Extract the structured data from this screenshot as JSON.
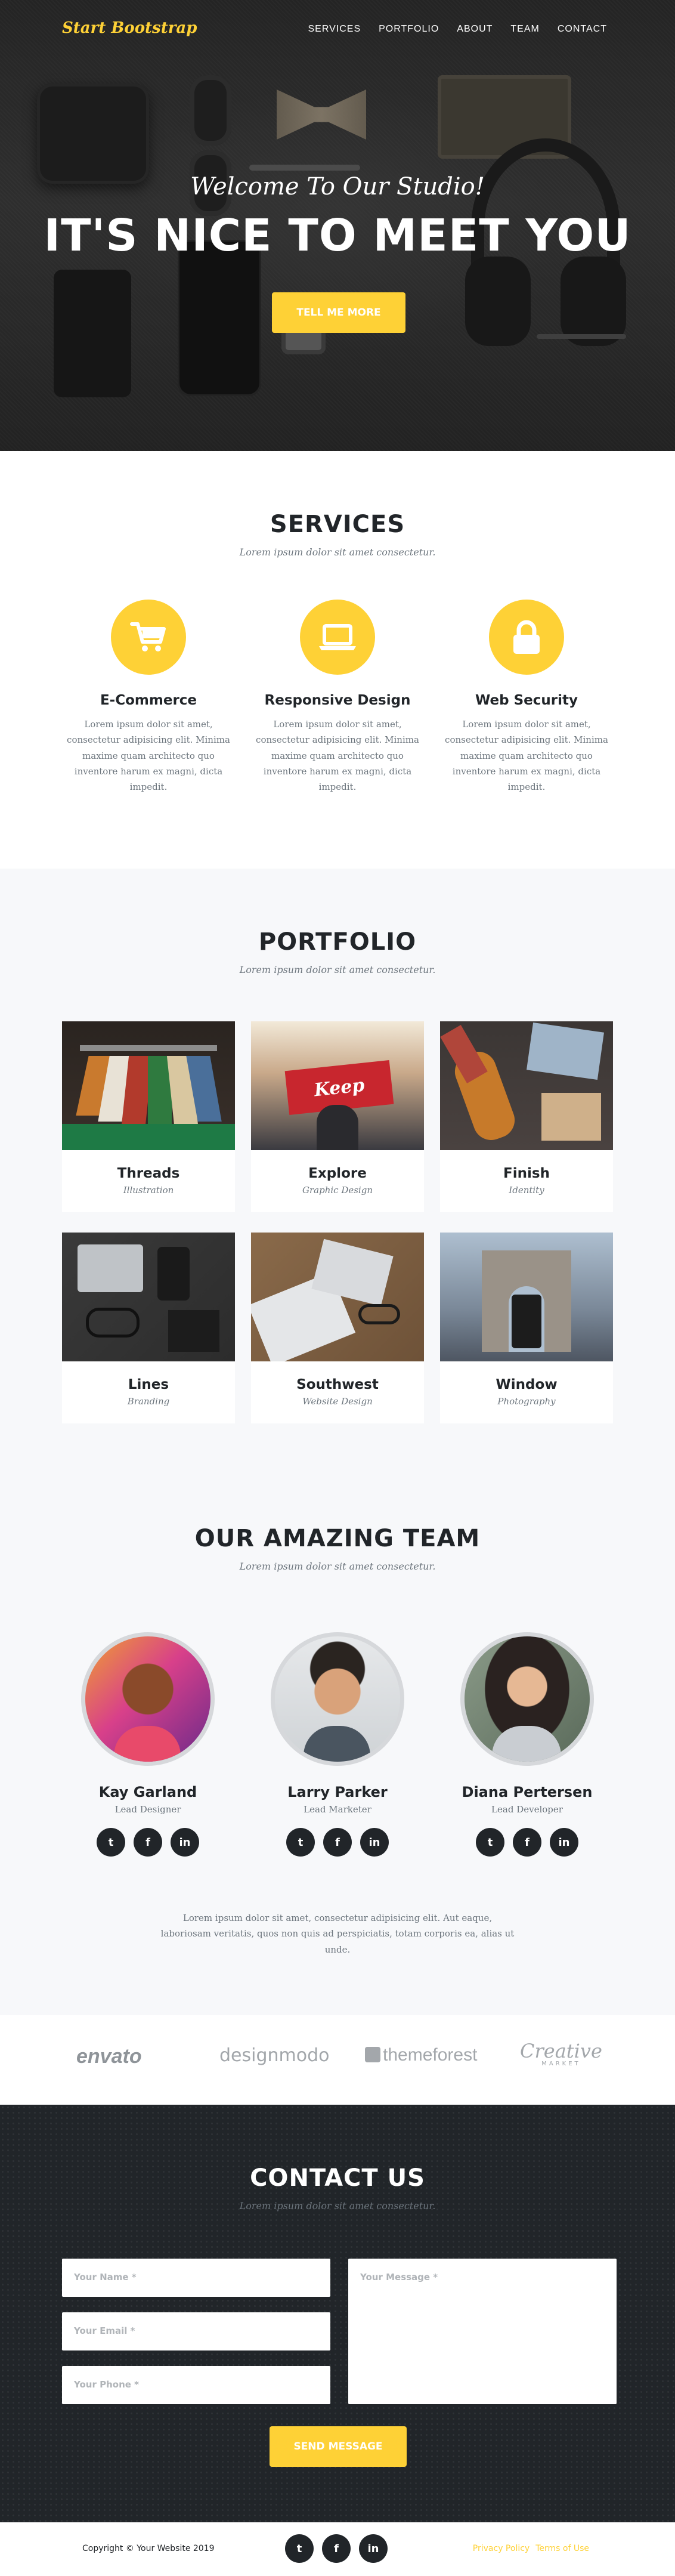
{
  "header": {
    "brand": "Start Bootstrap",
    "nav": [
      "SERVICES",
      "PORTFOLIO",
      "ABOUT",
      "TEAM",
      "CONTACT"
    ]
  },
  "hero": {
    "lead": "Welcome To Our Studio!",
    "heading": "IT'S NICE TO MEET YOU",
    "button": "TELL ME MORE"
  },
  "services": {
    "title": "SERVICES",
    "subtitle": "Lorem ipsum dolor sit amet consectetur.",
    "items": [
      {
        "name": "E-Commerce",
        "icon": "shopping-cart-icon",
        "text": "Lorem ipsum dolor sit amet, consectetur adipisicing elit. Minima maxime quam architecto quo inventore harum ex magni, dicta impedit."
      },
      {
        "name": "Responsive Design",
        "icon": "laptop-icon",
        "text": "Lorem ipsum dolor sit amet, consectetur adipisicing elit. Minima maxime quam architecto quo inventore harum ex magni, dicta impedit."
      },
      {
        "name": "Web Security",
        "icon": "lock-icon",
        "text": "Lorem ipsum dolor sit amet, consectetur adipisicing elit. Minima maxime quam architecto quo inventore harum ex magni, dicta impedit."
      }
    ]
  },
  "portfolio": {
    "title": "PORTFOLIO",
    "subtitle": "Lorem ipsum dolor sit amet consectetur.",
    "items": [
      {
        "title": "Threads",
        "category": "Illustration"
      },
      {
        "title": "Explore",
        "category": "Graphic Design"
      },
      {
        "title": "Finish",
        "category": "Identity"
      },
      {
        "title": "Lines",
        "category": "Branding"
      },
      {
        "title": "Southwest",
        "category": "Website Design"
      },
      {
        "title": "Window",
        "category": "Photography"
      }
    ],
    "explore_sign": "Keep"
  },
  "team": {
    "title": "OUR AMAZING TEAM",
    "subtitle": "Lorem ipsum dolor sit amet consectetur.",
    "members": [
      {
        "name": "Kay Garland",
        "role": "Lead Designer"
      },
      {
        "name": "Larry Parker",
        "role": "Lead Marketer"
      },
      {
        "name": "Diana Pertersen",
        "role": "Lead Developer"
      }
    ],
    "social_icons": [
      "twitter-icon",
      "facebook-icon",
      "linkedin-icon"
    ],
    "closing": "Lorem ipsum dolor sit amet, consectetur adipisicing elit. Aut eaque, laboriosam veritatis, quos non quis ad perspiciatis, totam corporis ea, alias ut unde."
  },
  "clients": {
    "logos": [
      "envato",
      "designmodo",
      "themeforest",
      "Creative",
      "MARKET"
    ]
  },
  "contact": {
    "title": "CONTACT US",
    "subtitle": "Lorem ipsum dolor sit amet consectetur.",
    "name_placeholder": "Your Name *",
    "email_placeholder": "Your Email *",
    "phone_placeholder": "Your Phone *",
    "message_placeholder": "Your Message *",
    "button": "SEND MESSAGE"
  },
  "footer": {
    "copyright": "Copyright © Your Website 2019",
    "privacy": "Privacy Policy",
    "terms": "Terms of Use"
  },
  "colors": {
    "accent": "#fed136",
    "dark": "#212529",
    "muted": "#6c757d",
    "light_bg": "#f7f8fa"
  }
}
